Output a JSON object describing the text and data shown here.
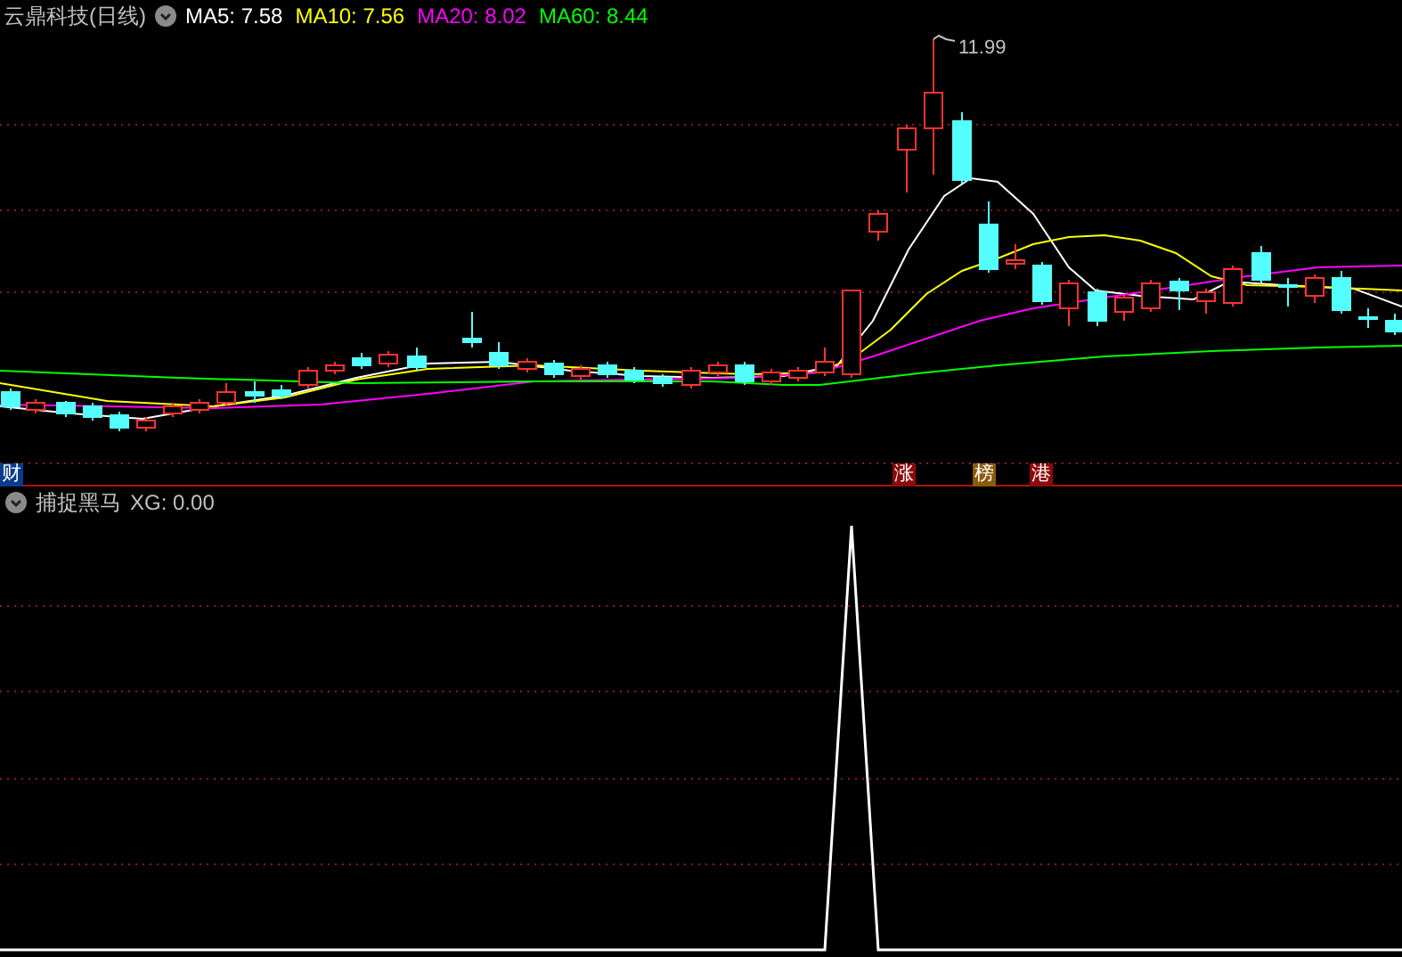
{
  "chart_header": {
    "title": "云鼎科技(日线)",
    "ma": [
      {
        "text": "MA5: 7.58",
        "color": "#ffffff"
      },
      {
        "text": "MA10: 7.56",
        "color": "#ffff00"
      },
      {
        "text": "MA20: 8.02",
        "color": "#ff00ff"
      },
      {
        "text": "MA60: 8.44",
        "color": "#00ff00"
      }
    ]
  },
  "high_label": "11.99",
  "markers": [
    {
      "text": "财",
      "color": "#0a3c8c"
    },
    {
      "text": "涨",
      "color": "#8c0a0a"
    },
    {
      "text": "榜",
      "color": "#8c5a0a"
    },
    {
      "text": "港",
      "color": "#8c0a0a"
    }
  ],
  "indicator": {
    "name": "捕捉黑马",
    "reading": "XG: 0.00"
  }
}
